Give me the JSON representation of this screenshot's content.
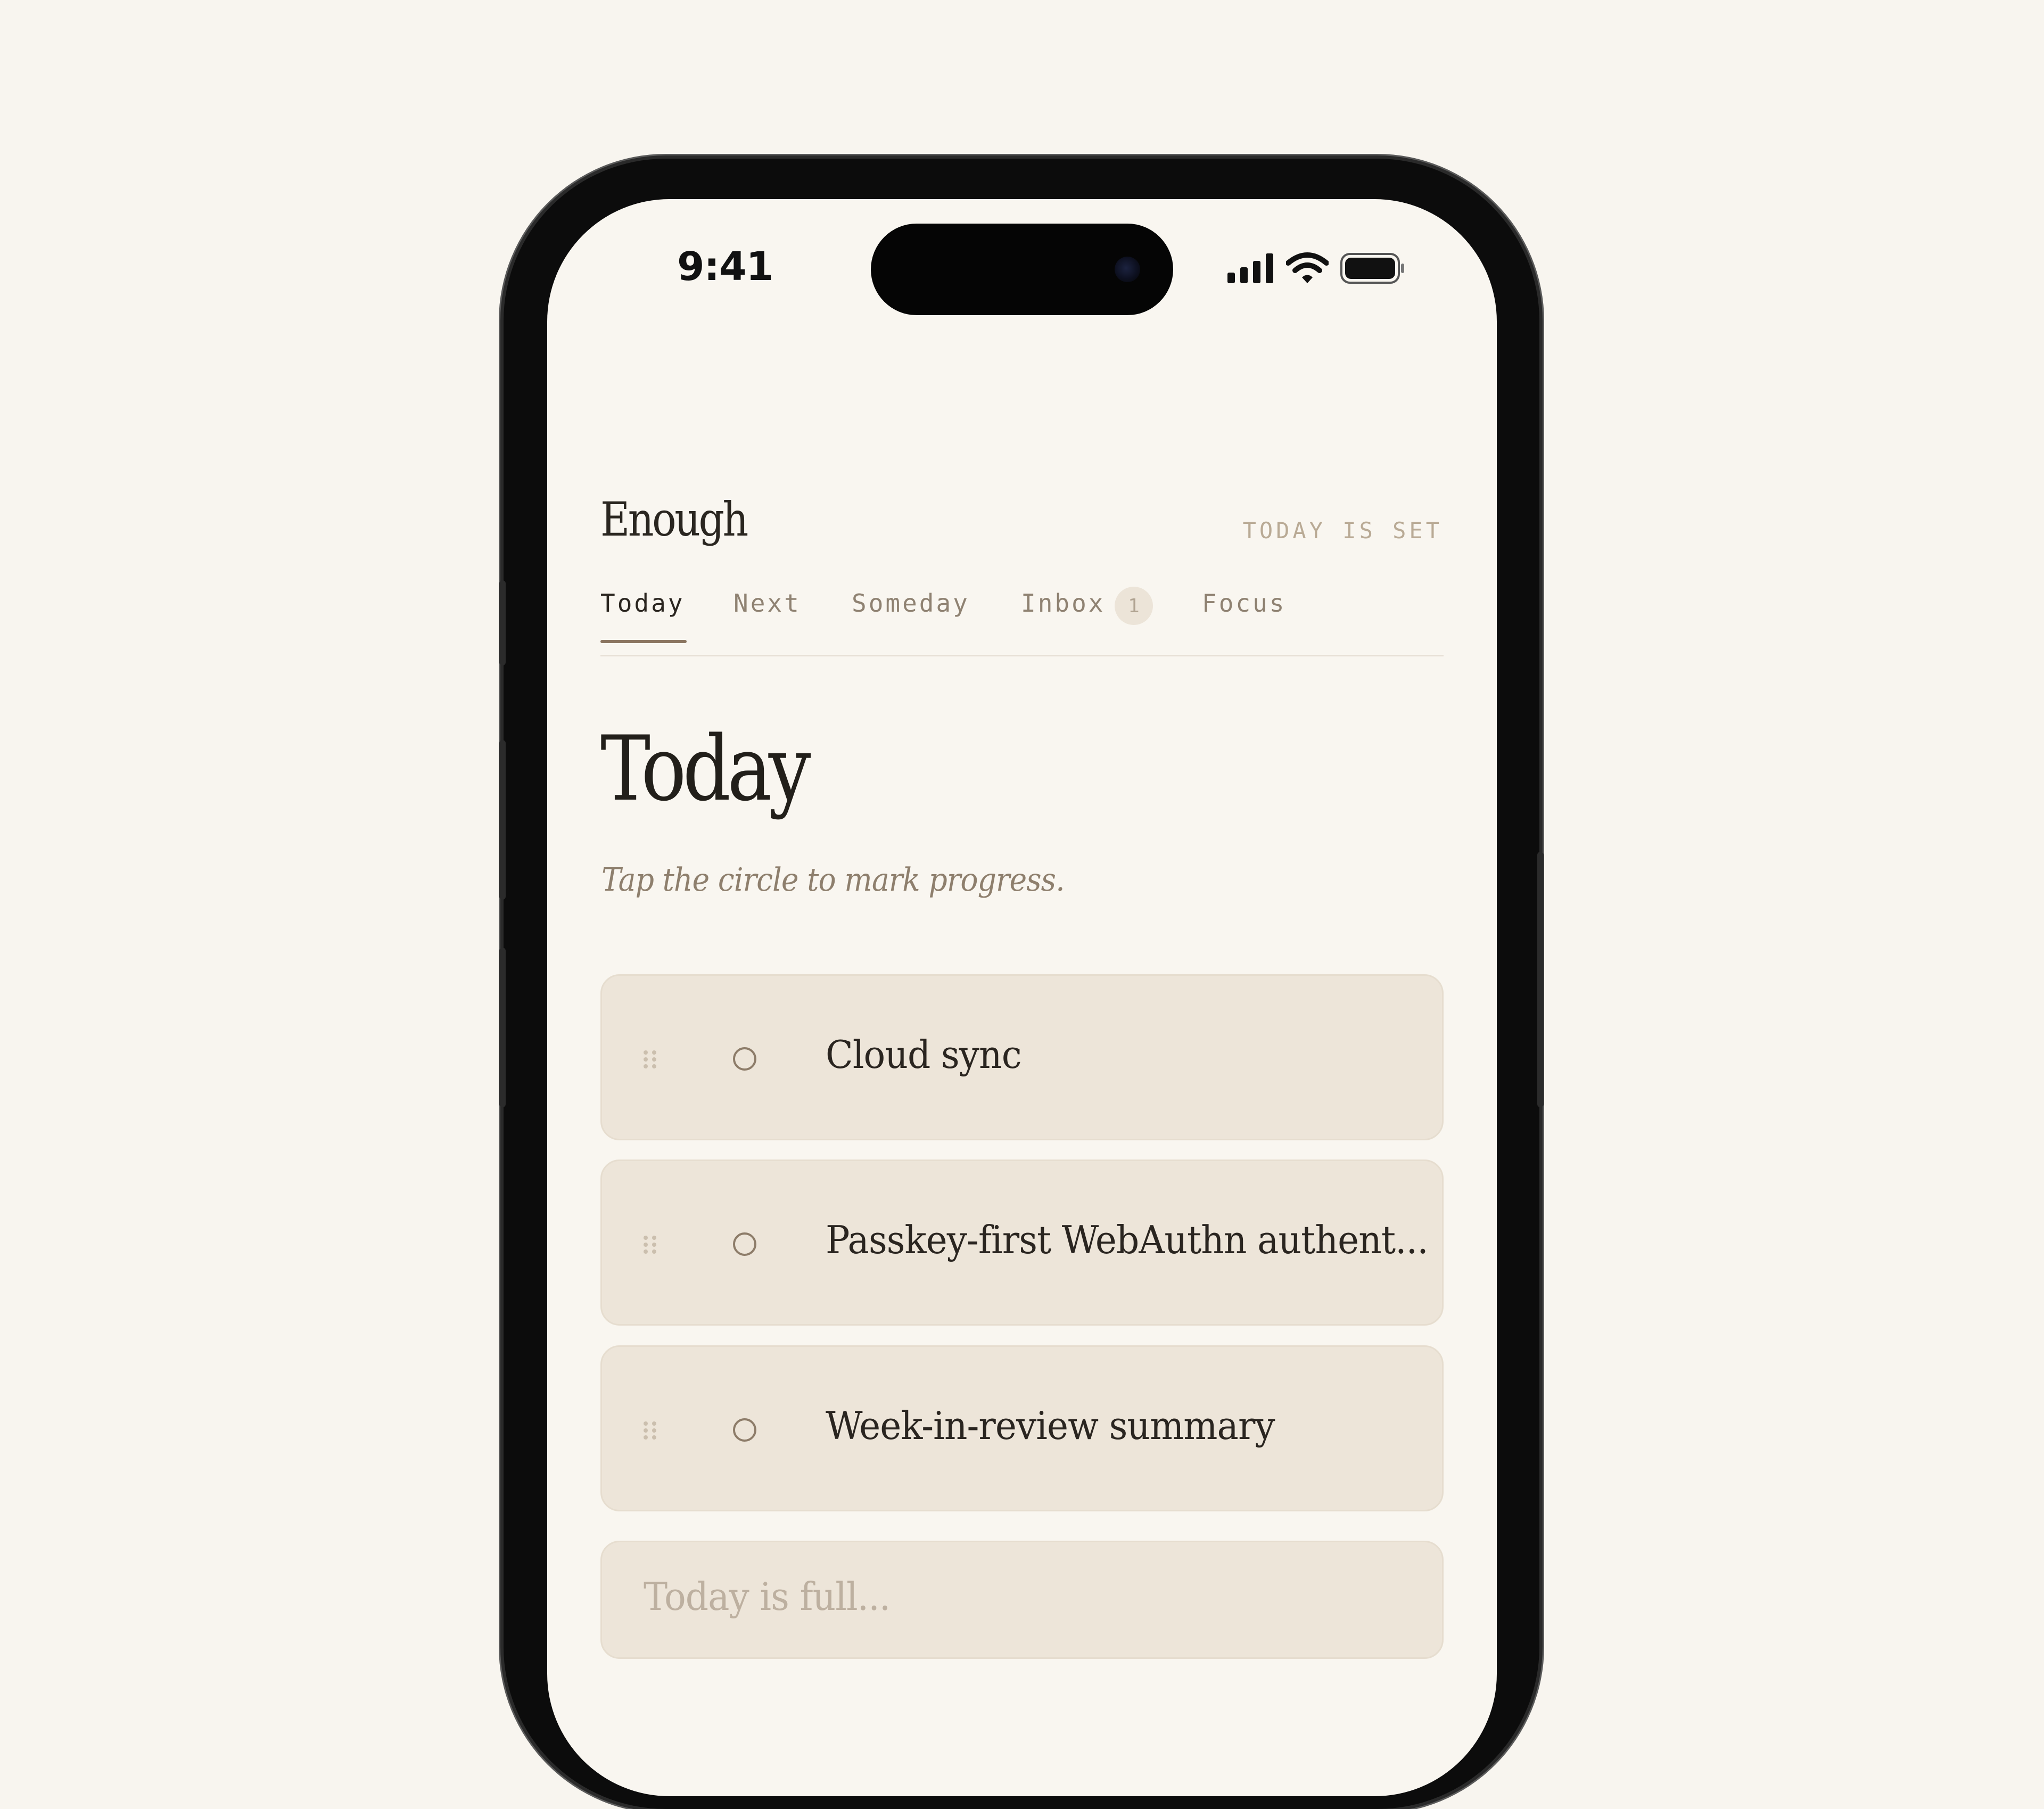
{
  "status_bar": {
    "time": "9:41",
    "icons": [
      "cellular-signal-icon",
      "wifi-icon",
      "battery-icon"
    ]
  },
  "app": {
    "title": "Enough",
    "header_status": "TODAY IS SET"
  },
  "tabs": [
    {
      "label": "Today",
      "active": true
    },
    {
      "label": "Next",
      "active": false
    },
    {
      "label": "Someday",
      "active": false
    },
    {
      "label": "Inbox",
      "active": false,
      "badge": "1"
    },
    {
      "label": "Focus",
      "active": false
    }
  ],
  "page": {
    "heading": "Today",
    "hint": "Tap the circle to mark progress."
  },
  "tasks": [
    {
      "title": "Cloud sync"
    },
    {
      "title": "Passkey-first WebAuthn authent..."
    },
    {
      "title": "Week-in-review summary"
    }
  ],
  "add_task": {
    "placeholder": "Today is full..."
  },
  "colors": {
    "background": "#f8f5ef",
    "card": "#ede5d9",
    "accent": "#8b7560",
    "text": "#221f1a",
    "muted": "#b9aa95"
  }
}
